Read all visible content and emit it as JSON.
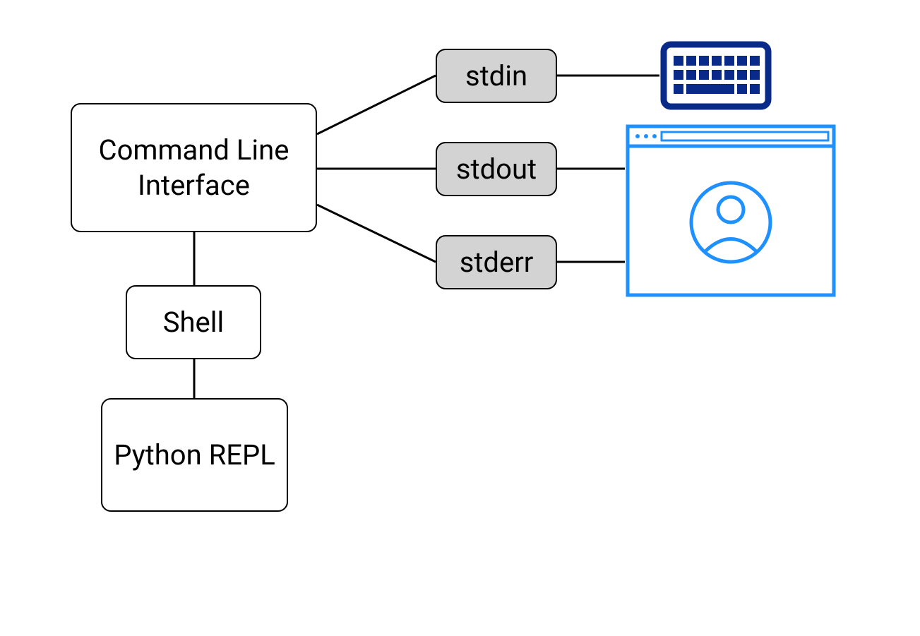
{
  "nodes": {
    "cli": "Command Line Interface",
    "shell": "Shell",
    "repl": "Python REPL",
    "stdin": "stdin",
    "stdout": "stdout",
    "stderr": "stderr"
  },
  "icons": {
    "keyboard": "keyboard-icon",
    "window": "user-window-icon"
  },
  "colors": {
    "keyboard": "#0a2a8a",
    "window": "#1e90ff",
    "nodeGray": "#d3d3d3",
    "stroke": "#000000"
  },
  "edges": [
    [
      "cli",
      "stdin"
    ],
    [
      "cli",
      "stdout"
    ],
    [
      "cli",
      "stderr"
    ],
    [
      "cli",
      "shell"
    ],
    [
      "shell",
      "repl"
    ],
    [
      "stdin",
      "keyboard"
    ],
    [
      "stdout",
      "window"
    ],
    [
      "stderr",
      "window"
    ]
  ]
}
